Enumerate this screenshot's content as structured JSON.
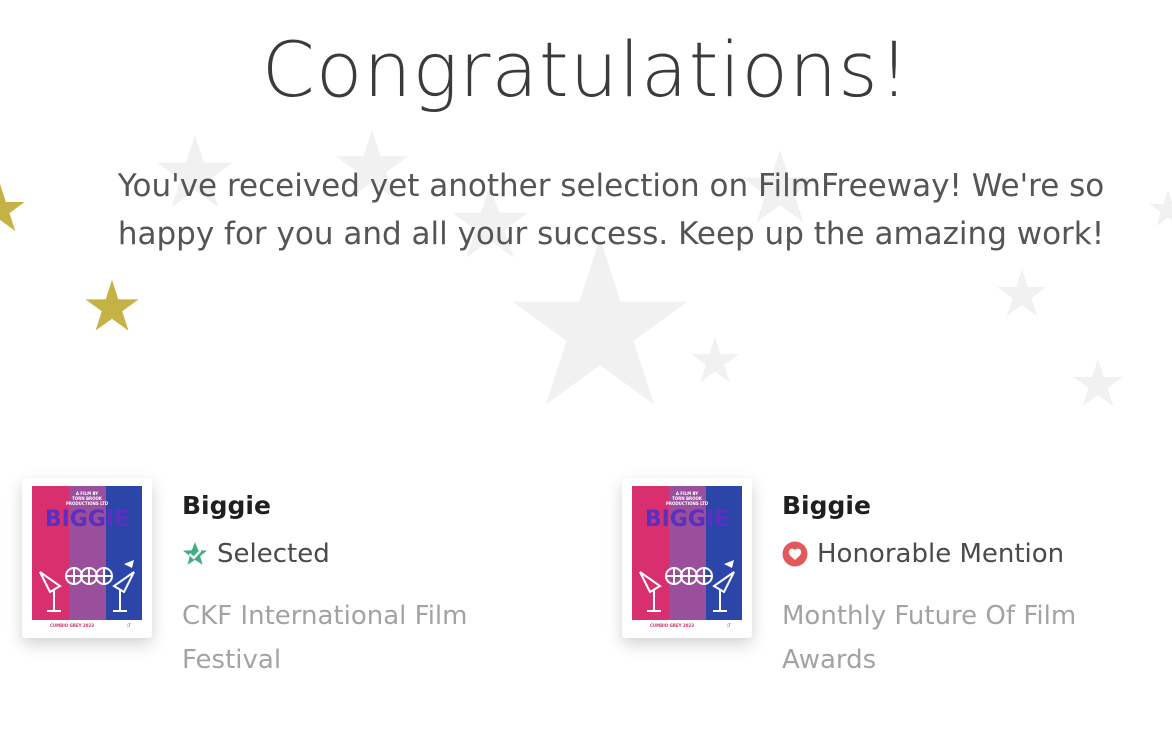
{
  "page": {
    "title": "Congratulations!",
    "message": "You've received yet another selection on FilmFreeway! We're so happy for you and all your success. Keep up the amazing work!"
  },
  "colors": {
    "gold_star": "#c4b245",
    "faint_star": "#f1f1f1",
    "selected_green": "#3fae82",
    "honorable_red": "#e1595a",
    "poster_pink": "#d8306f",
    "poster_purple": "#9a4f9c",
    "poster_blue": "#2b45a8"
  },
  "selections": [
    {
      "film_title": "Biggie",
      "status": "Selected",
      "status_icon": "star-check-icon",
      "festival": "CKF International Film Festival",
      "poster_title": "BIGGIE"
    },
    {
      "film_title": "Biggie",
      "status": "Honorable Mention",
      "status_icon": "heart-icon",
      "festival": "Monthly Future Of Film Awards",
      "poster_title": "BIGGIE"
    }
  ]
}
